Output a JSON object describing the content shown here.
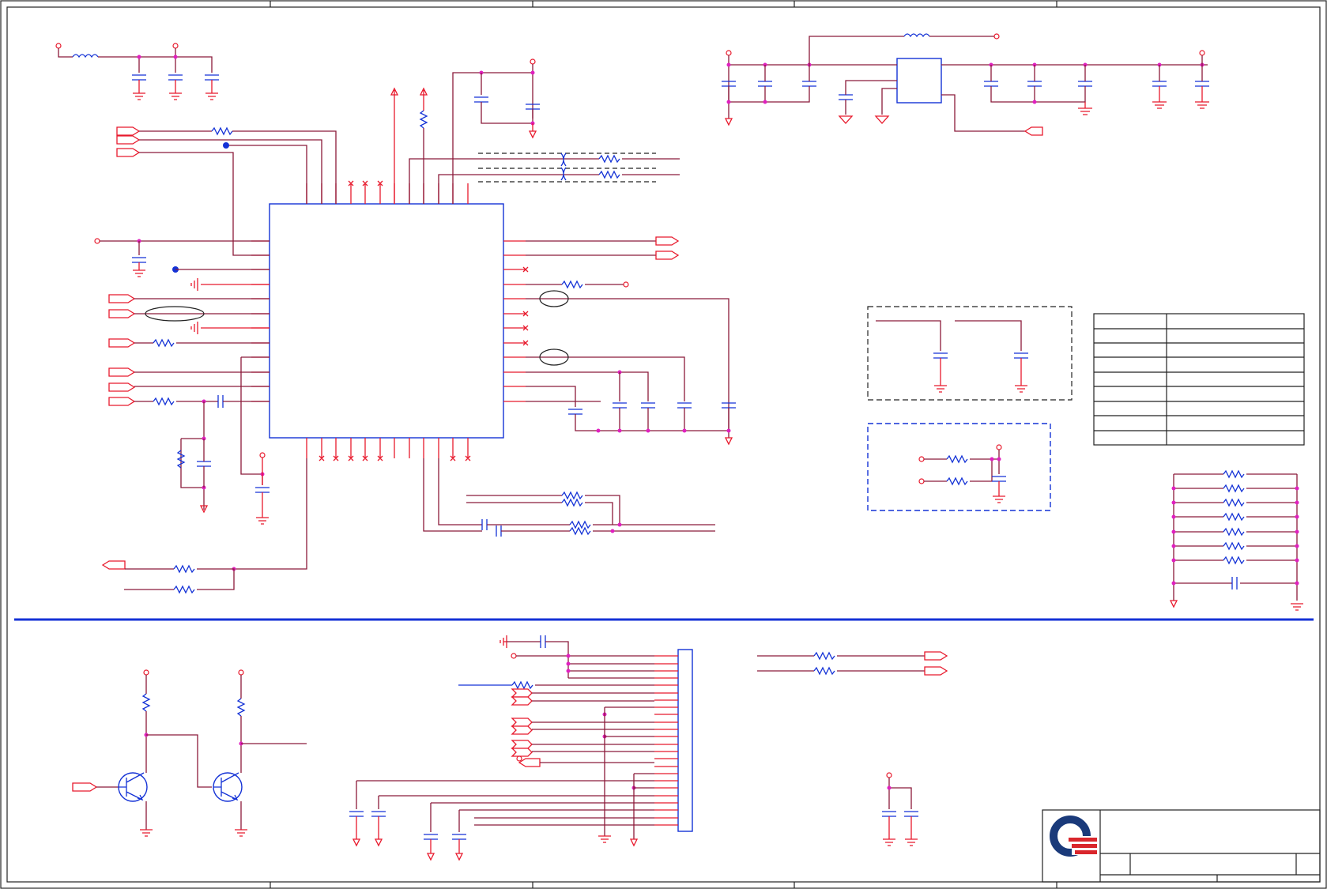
{
  "schematic": {
    "sheet_size": "1679x1125",
    "colors": {
      "wire": "#8b1a3a",
      "pin_wire": "#e8192c",
      "component": "#1432d6",
      "junction": "#e020c0",
      "frame": "#222222"
    },
    "logo": {
      "name": "quanta-logo",
      "colors": [
        "#1a3a7a",
        "#d9262c"
      ]
    },
    "components": {
      "main_ic": "large-ic",
      "regulator": "regulator-ic",
      "connector": "connector-header",
      "transistors": [
        "npn-transistor",
        "npn-transistor"
      ],
      "pin_table_rows": 8
    },
    "text": {}
  }
}
